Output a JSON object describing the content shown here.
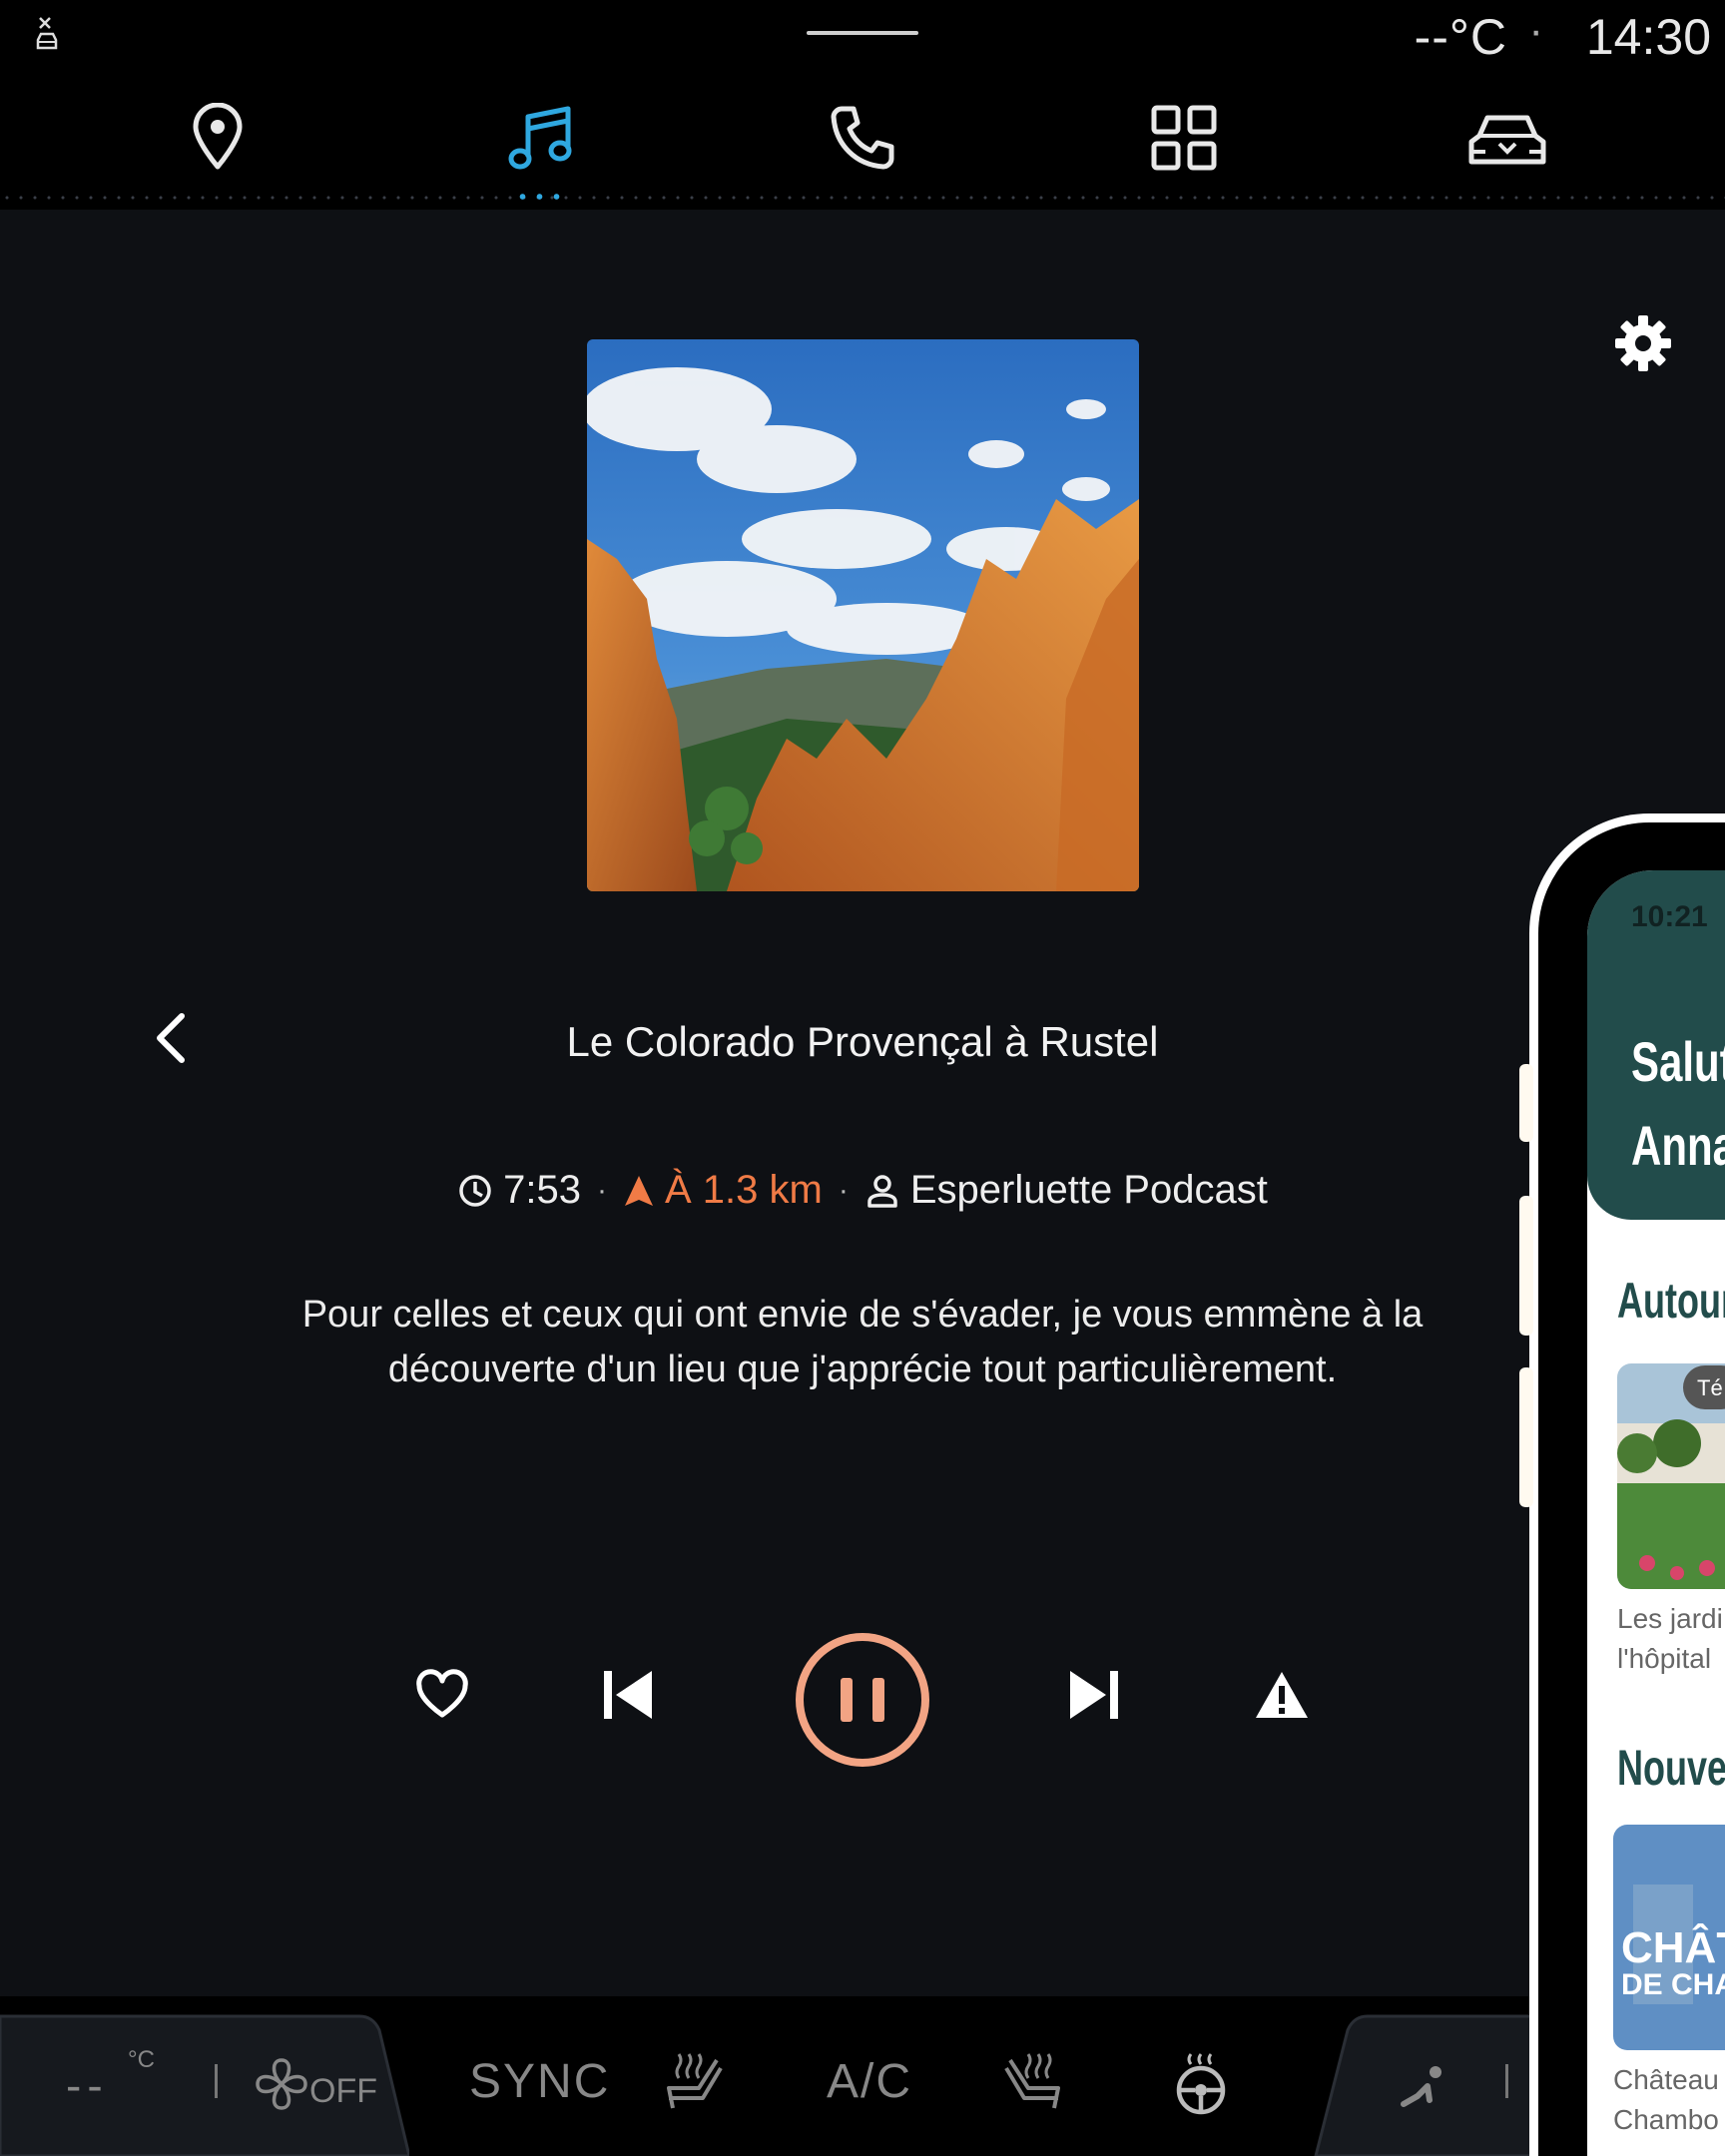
{
  "status_bar": {
    "temperature": "--°C",
    "separator": "·",
    "time": "14:30",
    "left_icon": "disconnected-car-icon"
  },
  "nav": {
    "items": [
      {
        "icon": "map-pin-icon",
        "active": false
      },
      {
        "icon": "music-note-icon",
        "active": true
      },
      {
        "icon": "phone-icon",
        "active": false
      },
      {
        "icon": "apps-grid-icon",
        "active": false
      },
      {
        "icon": "car-icon",
        "active": false
      }
    ],
    "accent_color": "#2fa8e0"
  },
  "player": {
    "title": "Le Colorado Provençal à Rustel",
    "duration": "7:53",
    "distance": "À 1.3 km",
    "author": "Esperluette Podcast",
    "meta_separator": "·",
    "description": "Pour celles et ceux qui ont envie de s'évader, je vous emmène à la découverte d'un lieu que j'apprécie tout particulièrement.",
    "accent_color": "#f07b46",
    "state": "playing"
  },
  "climate": {
    "temperature": "--",
    "unit": "°C",
    "fan_label": "OFF",
    "sync_label": "SYNC",
    "ac_label": "A/C"
  },
  "phone": {
    "time": "10:21",
    "greeting_line1": "Salut",
    "greeting_line2": "Anna",
    "section1": "Autour",
    "card1_badge": "Té",
    "card1_caption_line1": "Les jardi",
    "card1_caption_line2": "l'hôpital",
    "section2": "Nouvea",
    "card2_caption_line1": "Château",
    "card2_caption_line2": "Chambo",
    "card2_overlay_line1": "CHÂT",
    "card2_overlay_line2": "DE CHAN",
    "header_color": "#224c4b"
  }
}
